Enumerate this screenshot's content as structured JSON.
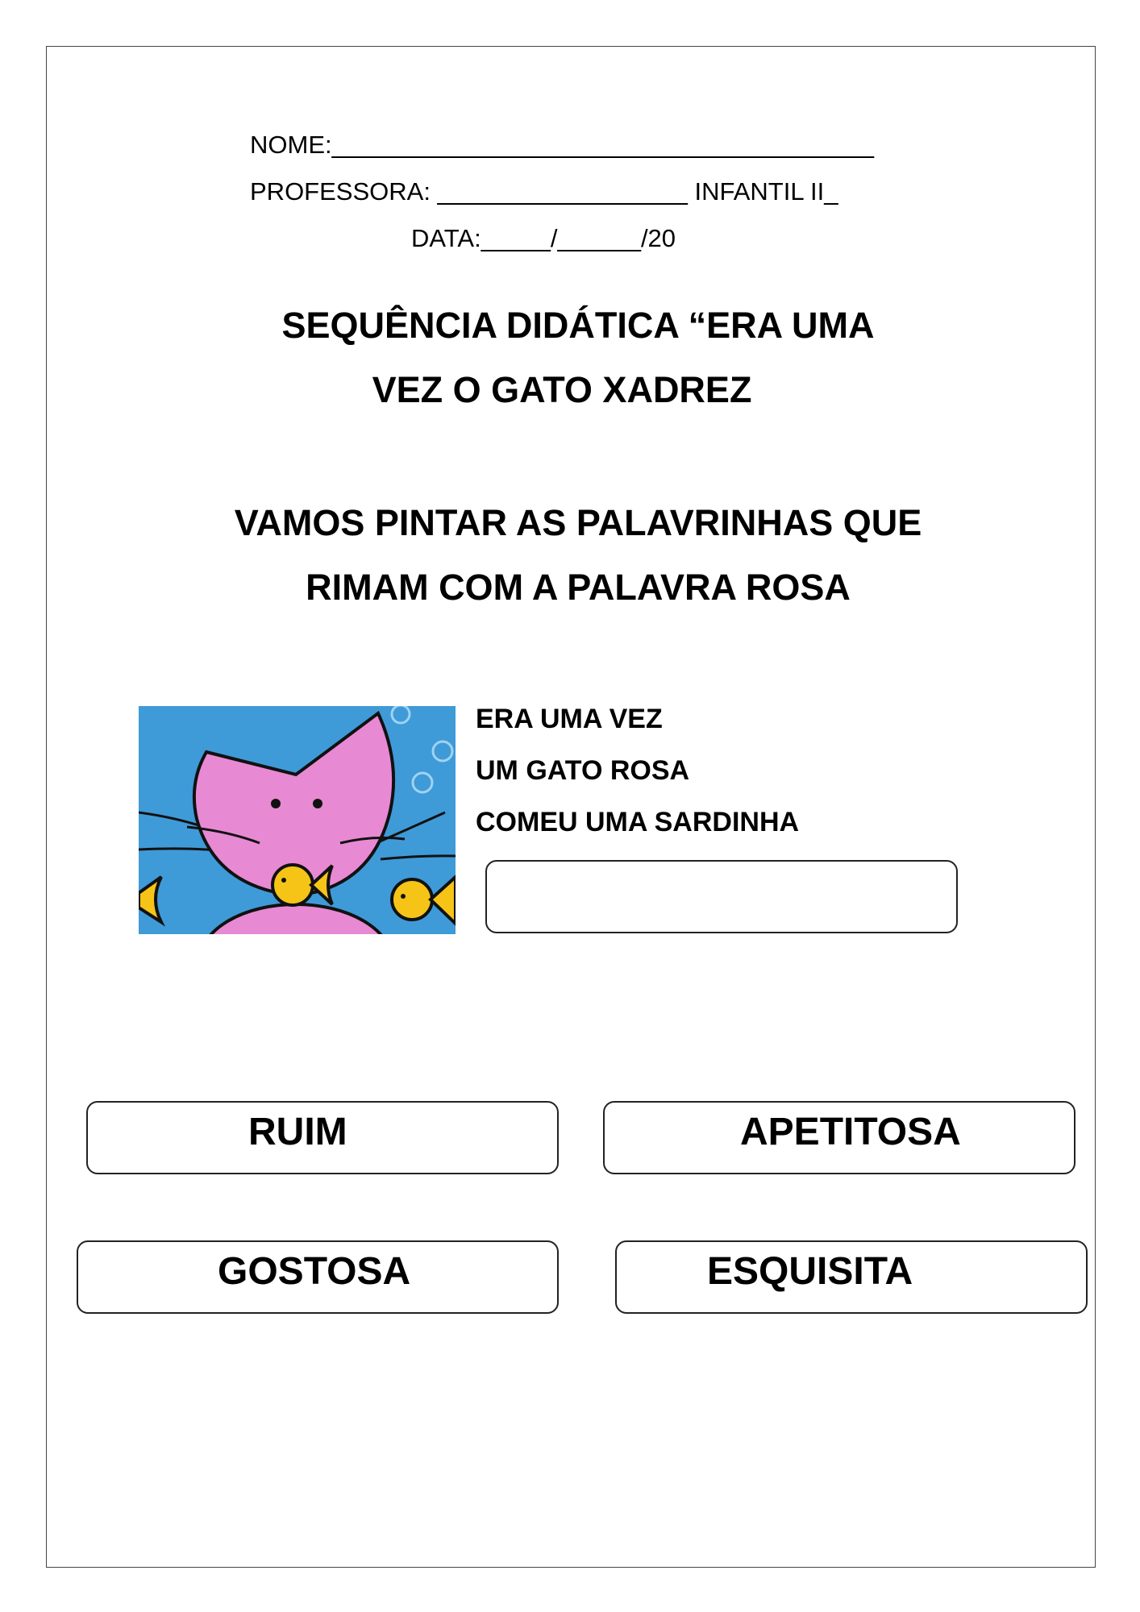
{
  "header": {
    "nome": "NOME:_______________________________________",
    "professora": "PROFESSORA: __________________ INFANTIL II_",
    "data": "DATA:_____/______/20"
  },
  "title": {
    "line1": "SEQUÊNCIA DIDÁTICA “ERA UMA",
    "line2": "VEZ O GATO XADREZ"
  },
  "instruction": {
    "line1": "VAMOS PINTAR AS PALAVRINHAS QUE",
    "line2": "RIMAM COM A PALAVRA ROSA"
  },
  "verse": [
    "ERA UMA VEZ",
    "UM GATO ROSA",
    "COMEU UMA SARDINHA"
  ],
  "answer_box_value": "",
  "words": [
    "RUIM",
    "APETITOSA",
    "GOSTOSA",
    "ESQUISITA"
  ],
  "colors": {
    "illustration_bg": "#3f9ad8",
    "cat_pink": "#e889d3",
    "fish_yellow": "#f5c417"
  },
  "icons": [
    "pink-cat-illustration",
    "yellow-fish-icon",
    "bubble-icon"
  ]
}
